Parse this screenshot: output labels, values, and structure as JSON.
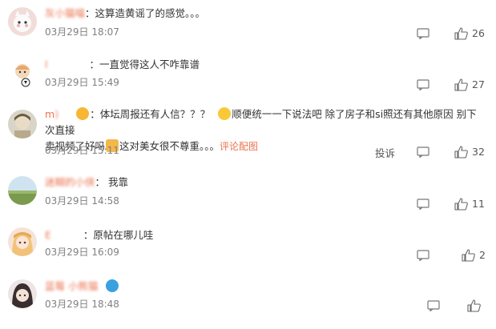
{
  "comments": [
    {
      "user": "灰小猫喵",
      "text": "这算造黄谣了的感觉。。。",
      "time": "03月29日 18:07",
      "likes": "26"
    },
    {
      "user": "l",
      "text": "一直觉得这人不咋靠谱",
      "time": "03月29日 15:49",
      "likes": "27"
    },
    {
      "user": "m",
      "text_a": "体坛周报还有人信？？？",
      "text_b": "顺便统一一下说法吧 除了房子和si照还有其他原因 别下次直接",
      "text_c": "卖视频了好吗",
      "text_d": "这对美女很不尊重。。。",
      "pic_link": "评论配图",
      "time": "03月29日 15:11",
      "report": "投诉",
      "likes": "32"
    },
    {
      "user": "迷糊的小侠",
      "text": "我靠",
      "time": "03月29日 14:58",
      "likes": "11"
    },
    {
      "user": "E",
      "text": "原帖在哪儿哇",
      "time": "03月29日 16:09",
      "likes": "2"
    },
    {
      "user": "蓝莓 小熊猫",
      "time": "03月29日 18:48"
    }
  ],
  "colors": {
    "username": "#eb7350",
    "timestamp": "#808080",
    "text": "#333333"
  }
}
